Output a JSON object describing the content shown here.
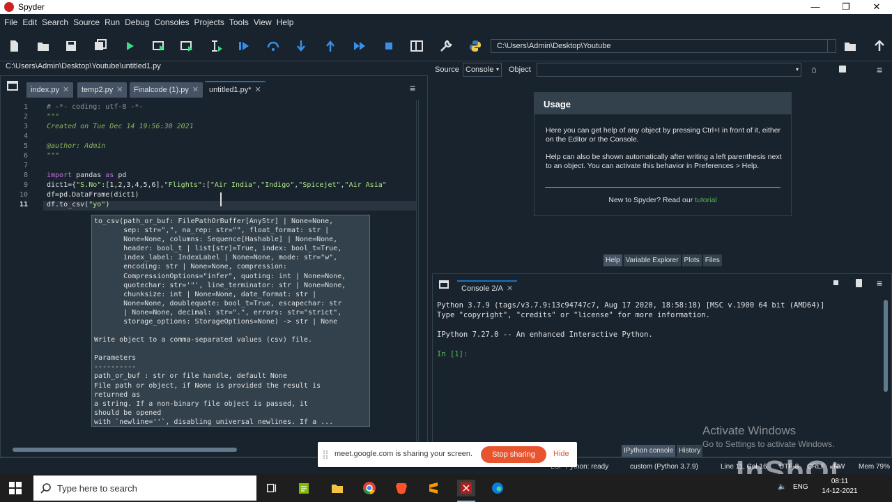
{
  "window": {
    "title": "Spyder",
    "min": "—",
    "max": "❐",
    "close": "✕"
  },
  "menu": [
    "File",
    "Edit",
    "Search",
    "Source",
    "Run",
    "Debug",
    "Consoles",
    "Projects",
    "Tools",
    "View",
    "Help"
  ],
  "toolbar": {
    "working_dir": "C:\\Users\\Admin\\Desktop\\Youtube"
  },
  "editor": {
    "file_path": "C:\\Users\\Admin\\Desktop\\Youtube\\untitled1.py",
    "tabs": [
      {
        "label": "index.py",
        "active": false
      },
      {
        "label": "temp2.py",
        "active": false
      },
      {
        "label": "Finalcode (1).py",
        "active": false
      },
      {
        "label": "untitled1.py*",
        "active": true
      }
    ],
    "line_numbers": [
      "1",
      "2",
      "3",
      "4",
      "5",
      "6",
      "7",
      "8",
      "9",
      "10",
      "11"
    ],
    "lines": {
      "l1": "# -*- coding: utf-8 -*-",
      "l2": "\"\"\"",
      "l3": "Created on Tue Dec 14 19:56:30 2021",
      "l5": "@author: Admin",
      "l6": "\"\"\"",
      "l8_kw1": "import",
      "l8_mid": " pandas ",
      "l8_kw2": "as",
      "l8_end": " pd",
      "l9_a": "dict1={",
      "l9_b": "\"S.No\"",
      "l9_c": ":[1,2,3,4,5,6],",
      "l9_d": "\"Flights\"",
      "l9_e": ":[",
      "l9_f": "\"Air India\"",
      "l9_g": ",",
      "l9_h": "\"Indigo\"",
      "l9_i": ",",
      "l9_j": "\"Spicejet\"",
      "l9_k": ",",
      "l9_l": "\"Air Asia\"",
      "l10": "df=pd.DataFrame(dict1)",
      "l11_a": "df.to_csv(",
      "l11_b": "\"yo\"",
      "l11_c": ")"
    }
  },
  "tooltip": {
    "signature": "to_csv(path_or_buf: FilePathOrBuffer[AnyStr] | None=None,\n       sep: str=\",\", na_rep: str=\"\", float_format: str |\n       None=None, columns: Sequence[Hashable] | None=None,\n       header: bool_t | list[str]=True, index: bool_t=True,\n       index_label: IndexLabel | None=None, mode: str=\"w\",\n       encoding: str | None=None, compression:\n       CompressionOptions=\"infer\", quoting: int | None=None,\n       quotechar: str='\"', line_terminator: str | None=None,\n       chunksize: int | None=None, date_format: str |\n       None=None, doublequote: bool_t=True, escapechar: str\n       | None=None, decimal: str=\".\", errors: str=\"strict\",\n       storage_options: StorageOptions=None) -> str | None",
    "description": "Write object to a comma-separated values (csv) file.",
    "params_header": "Parameters\n----------",
    "params": "path_or_buf : str or file handle, default None\nFile path or object, if None is provided the result is\nreturned as\na string. If a non-binary file object is passed, it\nshould be opened\nwith `newline=''`, disabling universal newlines. If a ..."
  },
  "help": {
    "source_label": "Source",
    "source_value": "Console",
    "object_label": "Object",
    "usage_title": "Usage",
    "p1": "Here you can get help of any object by pressing Ctrl+I in front of it, either on the Editor or the Console.",
    "p2": "Help can also be shown automatically after writing a left parenthesis next to an object. You can activate this behavior in Preferences > Help.",
    "new_text": "New to Spyder? Read our ",
    "tutorial": "tutorial",
    "tabs": [
      "Help",
      "Variable Explorer",
      "Plots",
      "Files"
    ]
  },
  "console": {
    "tab": "Console 2/A",
    "line1": "Python 3.7.9 (tags/v3.7.9:13c94747c7, Aug 17 2020, 18:58:18) [MSC v.1900 64 bit (AMD64)]",
    "line2": "Type \"copyright\", \"credits\" or \"license\" for more information.",
    "line3": "IPython 7.27.0 -- An enhanced Interactive Python.",
    "prompt": "In [1]:",
    "bottom_tabs": [
      "IPython console",
      "History"
    ]
  },
  "status": {
    "lsp": "LSP Python: ready",
    "env": "custom (Python 3.7.9)",
    "pos": "Line 11, Col 16",
    "enc": "UTF-8",
    "eol": "CRLF",
    "rw": "RW",
    "mem": "Mem 79%"
  },
  "share": {
    "message": "meet.google.com is sharing your screen.",
    "stop": "Stop sharing",
    "hide": "Hide"
  },
  "watermark": {
    "activate": "Activate Windows",
    "settings": "Go to Settings to activate Windows.",
    "brand": "InShOt"
  },
  "taskbar": {
    "search_placeholder": "Type here to search",
    "lang": "ENG",
    "time": "08:11",
    "date": "14-12-2021"
  },
  "colors": {
    "accent": "#1a72bb",
    "bg": "#19232d",
    "panel": "#32414b",
    "stop_sharing": "#e8542e"
  }
}
